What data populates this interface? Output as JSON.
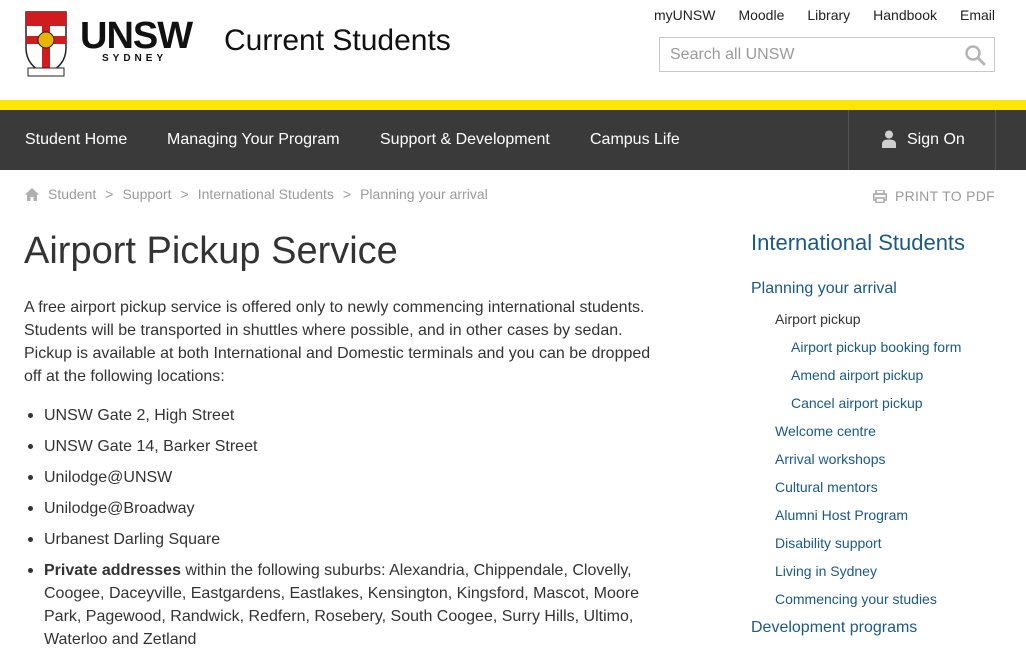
{
  "header": {
    "wordmark": "UNSW",
    "wordmark_sub": "SYDNEY",
    "site_title": "Current Students",
    "util_links": [
      "myUNSW",
      "Moodle",
      "Library",
      "Handbook",
      "Email"
    ],
    "search_placeholder": "Search all UNSW"
  },
  "nav": {
    "items": [
      "Student Home",
      "Managing Your Program",
      "Support & Development",
      "Campus Life"
    ],
    "sign_on": "Sign On"
  },
  "breadcrumb": {
    "items": [
      "Student",
      "Support",
      "International Students",
      "Planning your arrival"
    ],
    "separator": ">"
  },
  "print_label": "PRINT TO PDF",
  "main": {
    "title": "Airport Pickup Service",
    "intro": "A free airport pickup service is offered only to newly commencing international students. Students will be transported in shuttles where possible, and in other cases by sedan. Pickup is available at both International and Domestic terminals and you can be dropped off at the following locations:",
    "locations": [
      "UNSW Gate 2, High Street",
      "UNSW Gate 14, Barker Street",
      "Unilodge@UNSW",
      "Unilodge@Broadway",
      "Urbanest Darling Square"
    ],
    "private_bold": "Private addresses",
    "private_rest": " within the following suburbs: Alexandria, Chippendale, Clovelly, Coogee, Daceyville, Eastgardens, Eastlakes, Kensington, Kingsford, Mascot, Moore Park, Pagewood, Randwick, Redfern, Rosebery, South Coogee, Surry Hills, Ultimo, Waterloo and Zetland"
  },
  "sidebar": {
    "heading": "International Students",
    "section": "Planning your arrival",
    "current": "Airport pickup",
    "sub_items": [
      "Airport pickup booking form",
      "Amend airport pickup",
      "Cancel airport pickup"
    ],
    "items": [
      "Welcome centre",
      "Arrival workshops",
      "Cultural mentors",
      "Alumni Host Program",
      "Disability support",
      "Living in Sydney",
      "Commencing your studies"
    ],
    "next_section": "Development programs"
  },
  "colors": {
    "accent_yellow": "#ffe600",
    "nav_bg": "#3a3a3a",
    "link_blue": "#1a5a85"
  }
}
